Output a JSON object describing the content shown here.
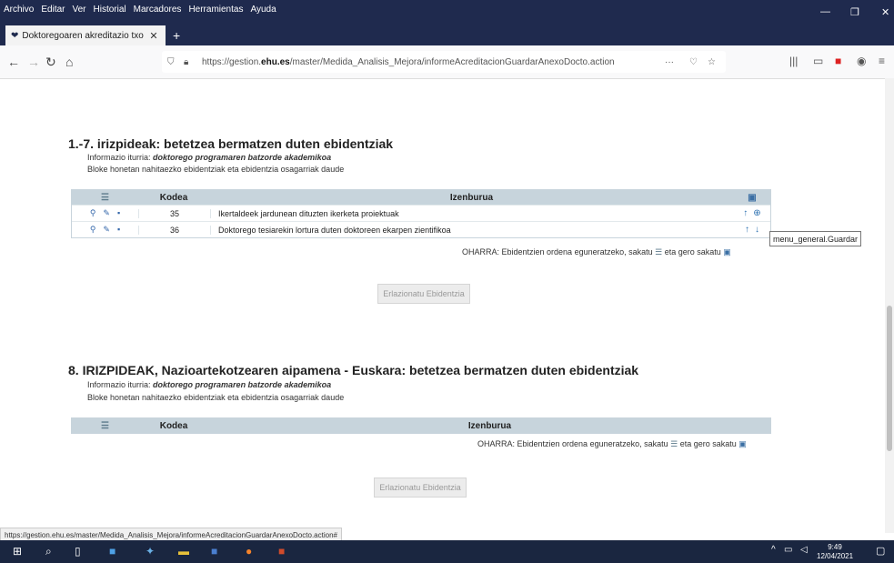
{
  "window": {
    "menu": [
      "Archivo",
      "Editar",
      "Ver",
      "Historial",
      "Marcadores",
      "Herramientas",
      "Ayuda"
    ],
    "controls": {
      "minimize": "—",
      "maximize": "❐",
      "close": "✕"
    }
  },
  "tab": {
    "title": "Doktoregoaren akreditazio txo",
    "close": "✕",
    "new_tab": "+"
  },
  "nav": {
    "url_prefix": "https://gestion.",
    "url_domain": "ehu.es",
    "url_path": "/master/Medida_Analisis_Mejora/informeAcreditacionGuardarAnexoDocto.action",
    "more": "···"
  },
  "section1": {
    "title": "1.-7. irizpideak: betetzea bermatzen duten ebidentziak",
    "info_label": "Informazio iturria:",
    "info_value": "doktorego programaren batzorde akademikoa",
    "desc": "Bloke honetan nahitaezko ebidentziak eta ebidentzia osagarriak daude",
    "headers": {
      "code": "Kodea",
      "title": "Izenburua"
    },
    "rows": [
      {
        "code": "35",
        "title": "Ikertaldeek jardunean dituzten ikerketa proiektuak"
      },
      {
        "code": "36",
        "title": "Doktorego tesiarekin lortura duten doktoreen ekarpen zientifikoa"
      }
    ],
    "note_a": "OHARRA: Ebidentzien ordena eguneratzeko, sakatu",
    "note_b": "eta gero sakatu",
    "button": "Erlazionatu Ebidentzia",
    "tooltip": "menu_general.Guardar"
  },
  "section2": {
    "title": "8. IRIZPIDEAK, Nazioartekotzearen aipamena - Euskara: betetzea bermatzen duten ebidentziak",
    "info_label": "Informazio iturria:",
    "info_value": "doktorego programaren batzorde akademikoa",
    "desc": "Bloke honetan nahitaezko ebidentziak eta ebidentzia osagarriak daude",
    "headers": {
      "code": "Kodea",
      "title": "Izenburua"
    },
    "note_a": "OHARRA: Ebidentzien ordena eguneratzeko, sakatu",
    "note_b": "eta gero sakatu",
    "button": "Erlazionatu Ebidentzia"
  },
  "status_url": "https://gestion.ehu.es/master/Medida_Analisis_Mejora/informeAcreditacionGuardarAnexoDocto.action#",
  "taskbar": {
    "time": "9:49",
    "date": "12/04/2021"
  },
  "colors": {
    "titlebar": "#1f2a4e",
    "table_header": "#c7d4dc",
    "taskbar": "#1a2640"
  }
}
